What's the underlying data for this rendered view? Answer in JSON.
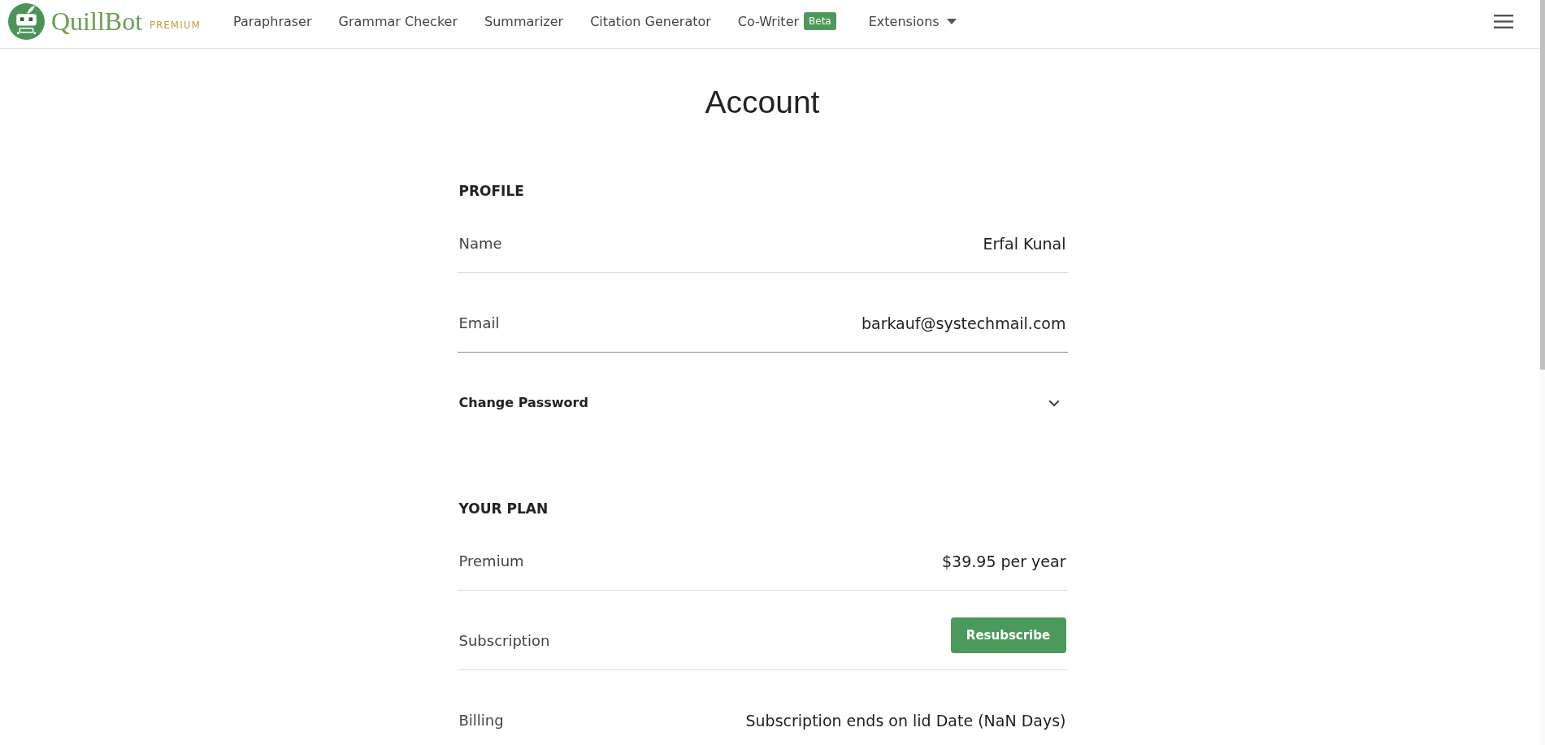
{
  "header": {
    "logo": {
      "wordmark": "QuillBot",
      "tier": "PREMIUM"
    },
    "nav": [
      {
        "kind": "link",
        "label": "Paraphraser"
      },
      {
        "kind": "link",
        "label": "Grammar Checker"
      },
      {
        "kind": "link",
        "label": "Summarizer"
      },
      {
        "kind": "link",
        "label": "Citation Generator"
      },
      {
        "kind": "link",
        "label": "Co-Writer",
        "badge": "Beta"
      },
      {
        "kind": "dropdown",
        "label": "Extensions"
      }
    ]
  },
  "page": {
    "title": "Account"
  },
  "sections": [
    {
      "heading": "PROFILE",
      "rows": [
        {
          "kind": "field",
          "label": "Name",
          "value": "Erfal Kunal",
          "focused": false
        },
        {
          "kind": "field",
          "label": "Email",
          "value": "barkauf@systechmail.com",
          "focused": true
        },
        {
          "kind": "toggle",
          "label": "Change Password",
          "expanded": false
        }
      ]
    },
    {
      "heading": "YOUR PLAN",
      "rows": [
        {
          "kind": "field",
          "label": "Premium",
          "value": "$39.95 per year",
          "focused": false
        },
        {
          "kind": "action",
          "label": "Subscription",
          "button": "Resubscribe",
          "focused": false
        },
        {
          "kind": "field",
          "label": "Billing",
          "value": "Subscription ends on lid Date (NaN Days)"
        }
      ]
    }
  ]
}
